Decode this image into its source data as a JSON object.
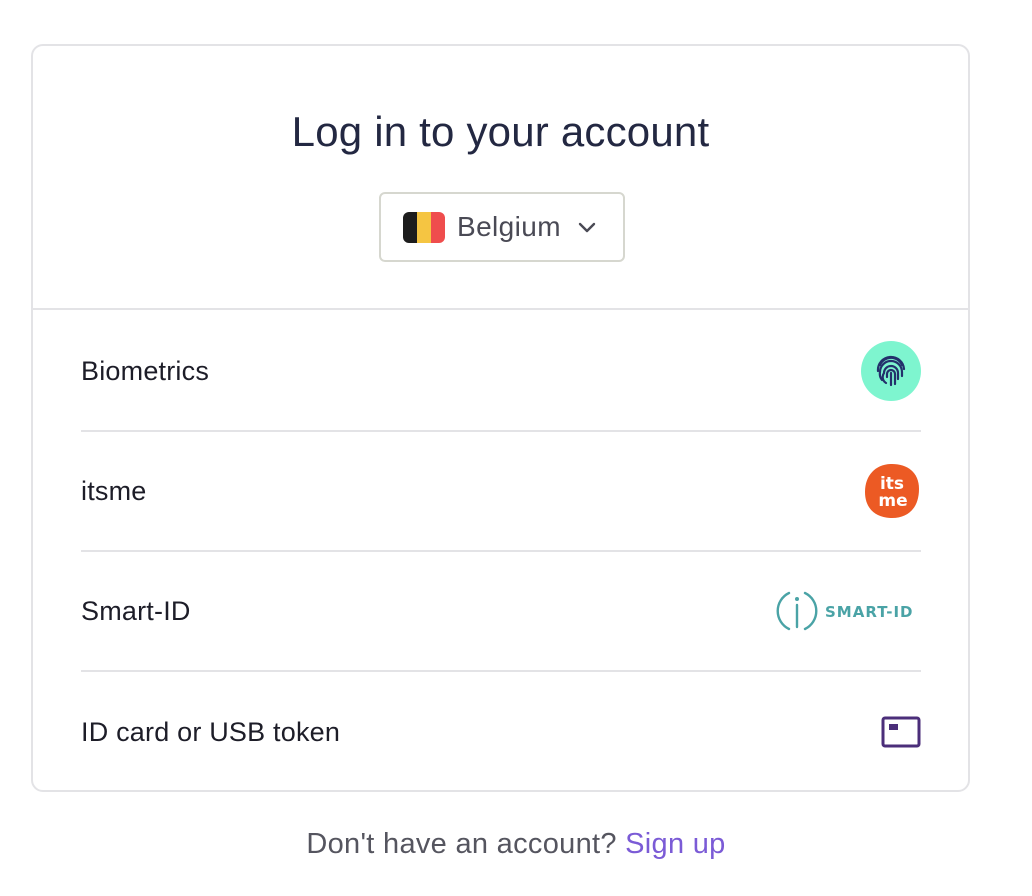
{
  "page": {
    "title": "Log in to your account"
  },
  "country_select": {
    "selected": "Belgium",
    "flag_colors": [
      "#1d1d1d",
      "#f5c542",
      "#ef4d4d"
    ]
  },
  "methods": [
    {
      "label": "Biometrics",
      "icon": "fingerprint-icon",
      "icon_bg": "#7ef5cf"
    },
    {
      "label": "itsme",
      "icon": "itsme-logo",
      "logo_text": "its me",
      "icon_bg": "#ec5a24"
    },
    {
      "label": "Smart-ID",
      "icon": "smart-id-logo",
      "logo_text": "SMART-ID",
      "accent": "#4aa3a6"
    },
    {
      "label": "ID card or USB token",
      "icon": "id-card-icon",
      "accent": "#4b2e7a"
    }
  ],
  "footer": {
    "prompt": "Don't have an account?",
    "link_label": "Sign up",
    "link_color": "#7b5bd6"
  }
}
